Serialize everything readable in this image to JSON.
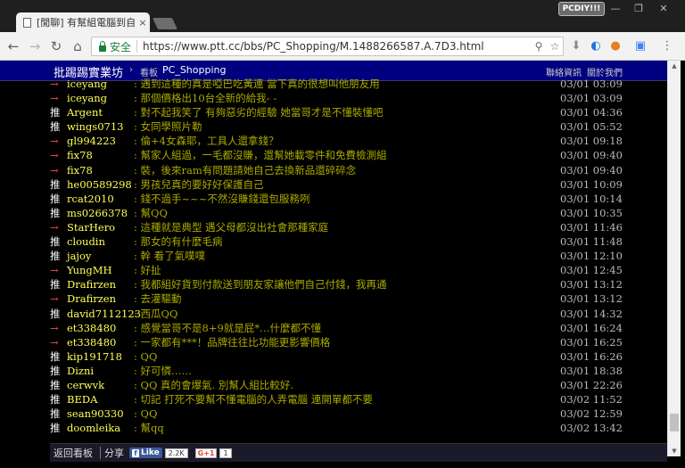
{
  "browser": {
    "tab_title": "[閒聊] 有幫組電腦到自己",
    "tab_close": "×",
    "badge": "PCDIY!!!",
    "window_controls": [
      "—",
      "❐",
      "✕"
    ],
    "security_label": "安全",
    "url": "https://www.ptt.cc/bbs/PC_Shopping/M.1488266587.A.7D3.html"
  },
  "topbar": {
    "site_link": "批踢踢實業坊",
    "separator": "›",
    "board_label": "看板",
    "board_name": "PC_Shopping",
    "contact_link": "聯絡資訊",
    "about_link": "關於我們"
  },
  "pushes": [
    {
      "tag": "→",
      "type": "arrow",
      "user": "iceyang",
      "content": ": 遇到這種的真是啞巴吃黃連 當下真的很想叫他朋友用",
      "ipdatetime": "03/01 03:09"
    },
    {
      "tag": "→",
      "type": "arrow",
      "user": "iceyang",
      "content": ": 那個價格出10台全新的給我- -",
      "ipdatetime": "03/01 03:09"
    },
    {
      "tag": "推",
      "type": "push",
      "user": "Argent",
      "content": ": 對不起我笑了 有夠惡劣的經驗 她當哥才是不懂裝懂吧",
      "ipdatetime": "03/01 04:36"
    },
    {
      "tag": "推",
      "type": "push",
      "user": "wings0713",
      "content": ": 女同學照片勒",
      "ipdatetime": "03/01 05:52"
    },
    {
      "tag": "→",
      "type": "arrow",
      "user": "gl994223",
      "content": ": 倫+4女森耶，工具人還拿錢？",
      "ipdatetime": "03/01 09:18"
    },
    {
      "tag": "→",
      "type": "arrow",
      "user": "fix78",
      "content": ": 幫家人組過，一毛都沒賺，還幫她載零件和免費檢測組",
      "ipdatetime": "03/01 09:40"
    },
    {
      "tag": "→",
      "type": "arrow",
      "user": "fix78",
      "content": ": 裝，後來ram有問題請她自己去換新品還碎碎念",
      "ipdatetime": "03/01 09:40"
    },
    {
      "tag": "推",
      "type": "push",
      "user": "he00589298",
      "content": ": 男孩兒真的要好好保護自己",
      "ipdatetime": "03/01 10:09"
    },
    {
      "tag": "推",
      "type": "push",
      "user": "rcat2010",
      "content": ": 錢不過手~~~不然沒賺錢還包服務咧",
      "ipdatetime": "03/01 10:14"
    },
    {
      "tag": "推",
      "type": "push",
      "user": "ms0266378",
      "content": ": 幫QQ",
      "ipdatetime": "03/01 10:35"
    },
    {
      "tag": "→",
      "type": "arrow",
      "user": "StarHero",
      "content": ": 這種就是典型  遇父母都沒出社會那種家庭",
      "ipdatetime": "03/01 11:46"
    },
    {
      "tag": "推",
      "type": "push",
      "user": "cloudin",
      "content": ": 那女的有什麼毛病",
      "ipdatetime": "03/01 11:48"
    },
    {
      "tag": "推",
      "type": "push",
      "user": "jajoy",
      "content": ": 幹 看了氣噗噗",
      "ipdatetime": "03/01 12:10"
    },
    {
      "tag": "→",
      "type": "arrow",
      "user": "YungMH",
      "content": ": 好扯",
      "ipdatetime": "03/01 12:45"
    },
    {
      "tag": "推",
      "type": "push",
      "user": "Drafirzen",
      "content": ": 我都組好貨到付款送到朋友家讓他們自己付錢，我再通",
      "ipdatetime": "03/01 13:12"
    },
    {
      "tag": "→",
      "type": "arrow",
      "user": "Drafirzen",
      "content": ": 去灌驅動",
      "ipdatetime": "03/01 13:12"
    },
    {
      "tag": "推",
      "type": "push",
      "user": "david7112123",
      "content": ": 西瓜QQ",
      "ipdatetime": "03/01 14:32"
    },
    {
      "tag": "→",
      "type": "arrow",
      "user": "et338480",
      "content": ": 感覺當哥不是8+9就是屁*…什麼都不懂",
      "ipdatetime": "03/01 16:24"
    },
    {
      "tag": "→",
      "type": "arrow",
      "user": "et338480",
      "content": ": 一家都有***！品牌往往比功能更影響價格",
      "ipdatetime": "03/01 16:25"
    },
    {
      "tag": "推",
      "type": "push",
      "user": "kip191718",
      "content": ": QQ",
      "ipdatetime": "03/01 16:26"
    },
    {
      "tag": "推",
      "type": "push",
      "user": "Dizni",
      "content": ": 好可憐……",
      "ipdatetime": "03/01 18:38"
    },
    {
      "tag": "推",
      "type": "push",
      "user": "cerwvk",
      "content": ": QQ  真的會爆氣. 別幫人組比較好.",
      "ipdatetime": "03/01 22:26"
    },
    {
      "tag": "推",
      "type": "push",
      "user": "BEDA",
      "content": ": 切記 打死不要幫不懂電腦的人弄電腦 連開單都不要",
      "ipdatetime": "03/02 11:52"
    },
    {
      "tag": "推",
      "type": "push",
      "user": "sean90330",
      "content": ": QQ",
      "ipdatetime": "03/02 12:59"
    },
    {
      "tag": "推",
      "type": "push",
      "user": "doomleika",
      "content": ": 幫qq",
      "ipdatetime": "03/02 13:42"
    }
  ],
  "bottombar": {
    "back_label": "返回看板",
    "share_label": "分享",
    "fb_like_label": "Like",
    "fb_count": "2.2K",
    "gplus_label": "G+1",
    "gplus_count": "1"
  },
  "colors": {
    "push_tag": "#ffffff",
    "arrow_tag": "#ff4d4d",
    "user": "#ffff55",
    "content": "#aaaa00",
    "topbar": "#000080"
  }
}
